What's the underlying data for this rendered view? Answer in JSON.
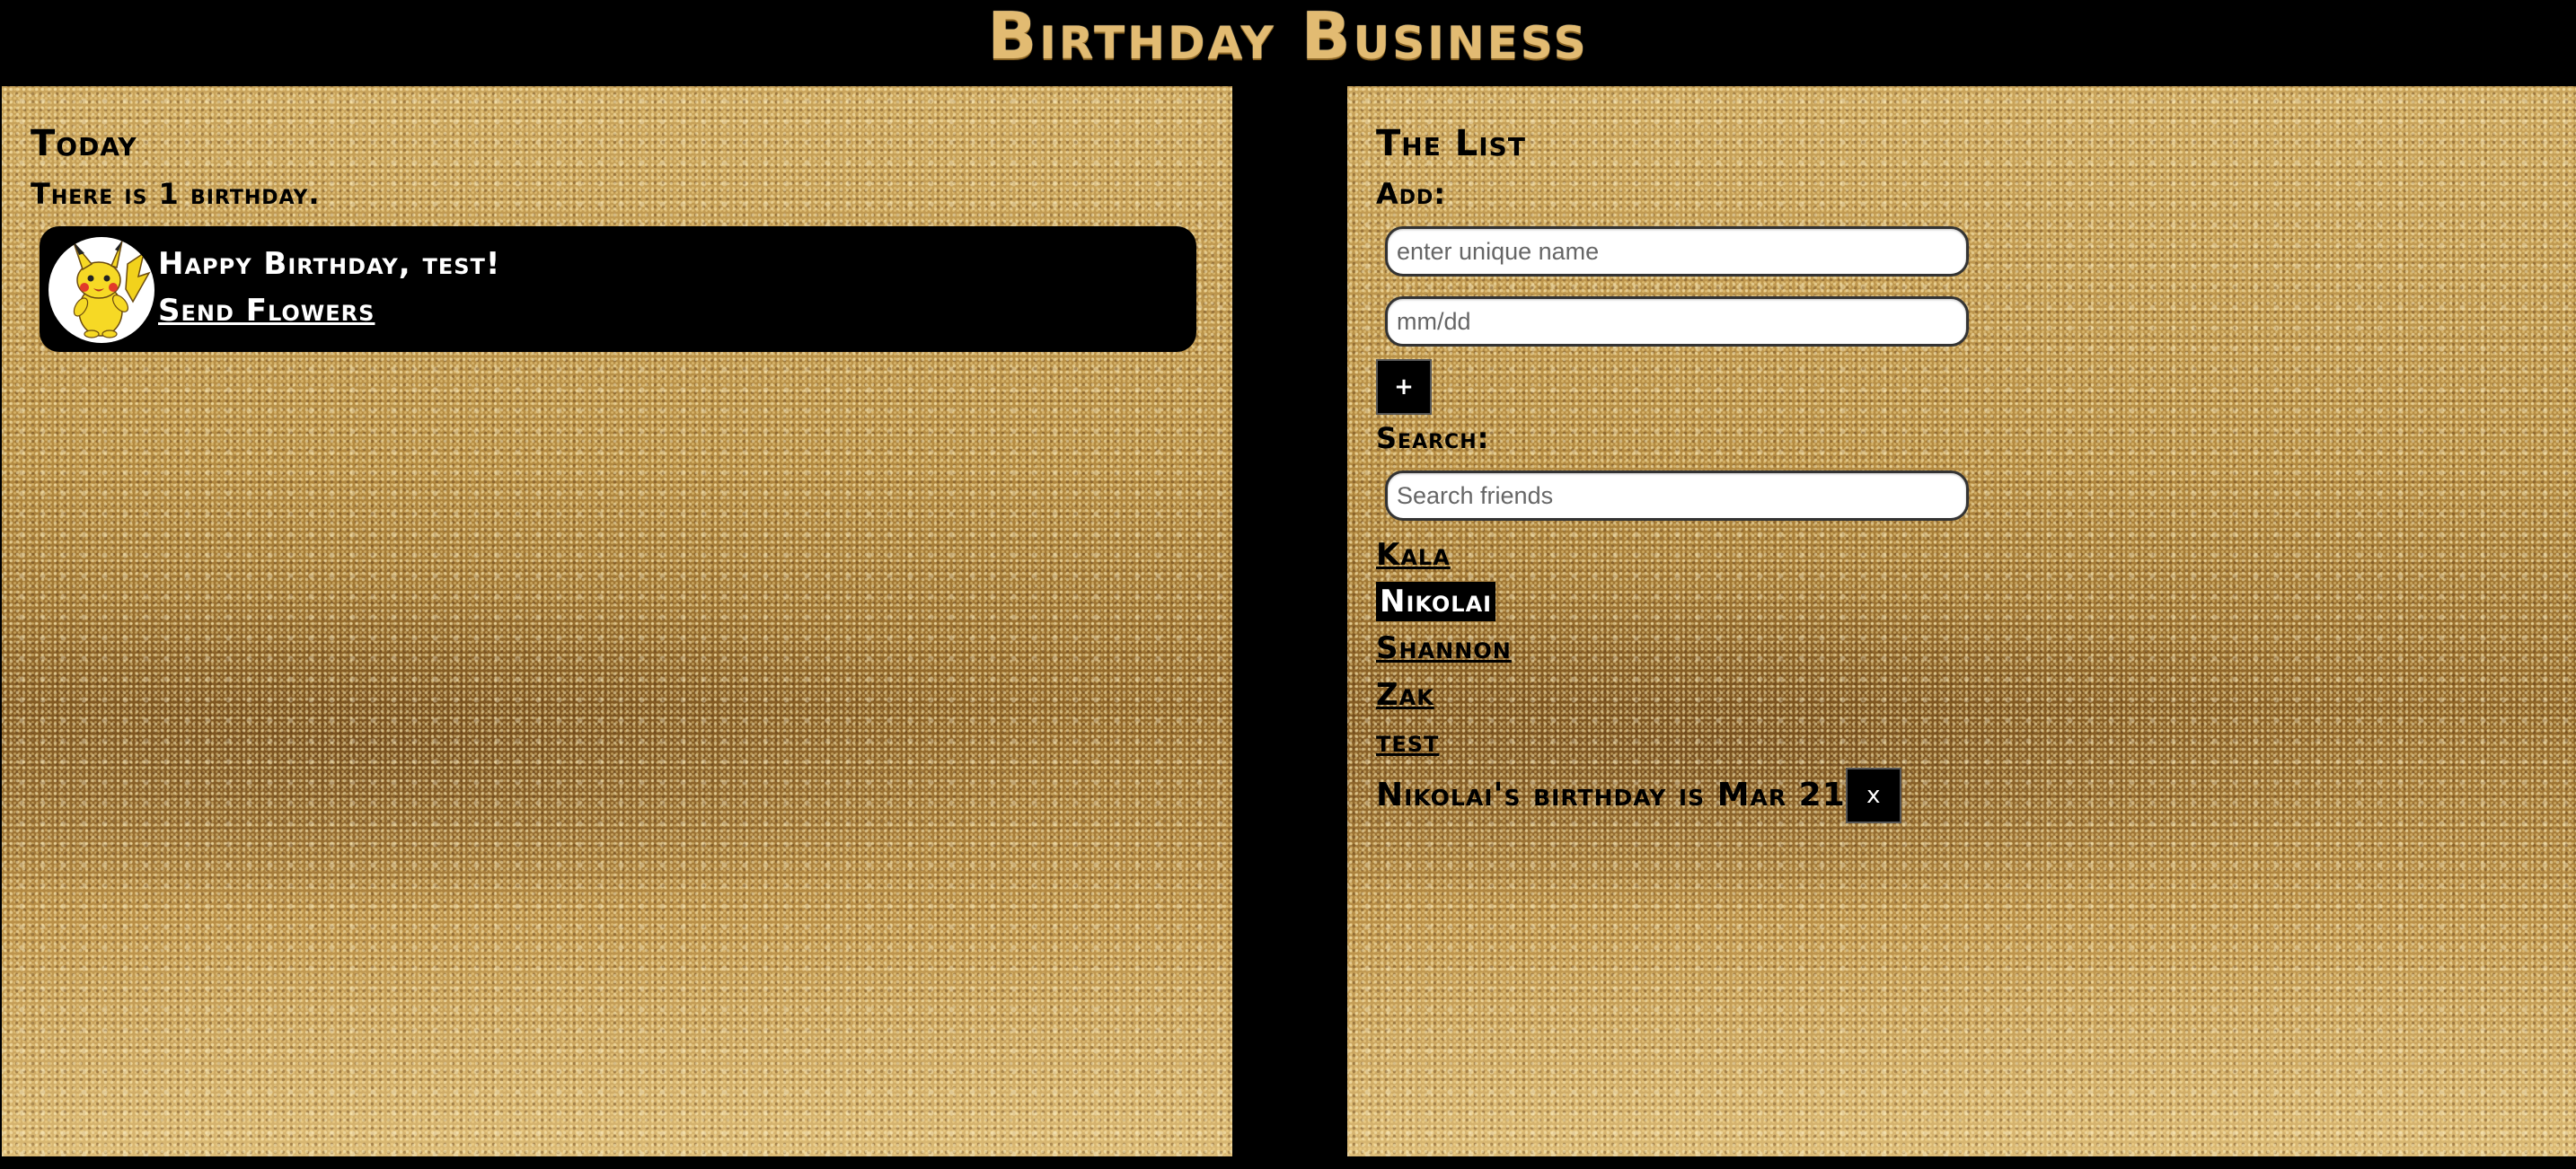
{
  "app": {
    "title": "Birthday Business"
  },
  "today": {
    "heading": "Today",
    "summary": "There is 1 birthday.",
    "cards": [
      {
        "greeting": "Happy Birthday, test!",
        "link_label": "Send Flowers",
        "avatar_icon": "pikachu-avatar-icon"
      }
    ]
  },
  "list": {
    "heading": "The List",
    "add_label": "Add:",
    "name_placeholder": "enter unique name",
    "date_placeholder": "mm/dd",
    "add_button_label": "+",
    "search_label": "Search:",
    "search_placeholder": "Search friends",
    "friends": [
      "Kala",
      "Nikolai",
      "Shannon",
      "Zak",
      "test"
    ],
    "selected_friend": "Nikolai",
    "detail_text": "Nikolai's birthday is Mar 21",
    "delete_button_label": "x"
  },
  "colors": {
    "title_gold": "#e2bb72",
    "background": "#000000",
    "panel_gold": "#b48a3e"
  }
}
